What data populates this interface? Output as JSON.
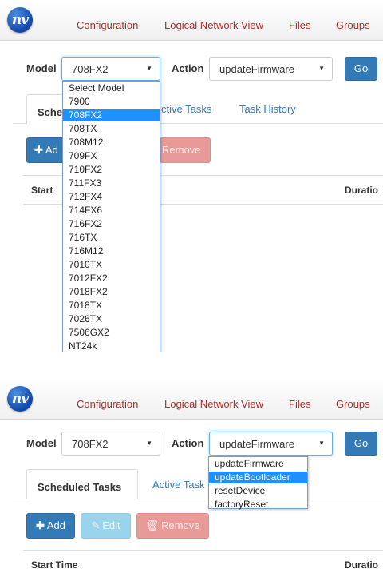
{
  "logo_text": "nv",
  "nav": {
    "items": [
      "Configuration",
      "Logical Network View",
      "Files",
      "Groups"
    ]
  },
  "panel1": {
    "model_label": "Model",
    "model_value": "708FX2",
    "action_label": "Action",
    "action_value": "updateFirmware",
    "go_label": "Go",
    "tab_scheduled_partial": "Sche",
    "tab_active_partial": "ctive Tasks",
    "tab_history": "Task History",
    "add_partial": "Ad",
    "remove_label": "Remove",
    "col_start_partial": "Start",
    "col_duration_partial": "Duratio",
    "model_options": [
      "Select Model",
      "7900",
      "708FX2",
      "708TX",
      "708M12",
      "709FX",
      "710FX2",
      "711FX3",
      "712FX4",
      "714FX6",
      "716FX2",
      "716TX",
      "716M12",
      "7010TX",
      "7012FX2",
      "7018FX2",
      "7018TX",
      "7026TX",
      "7506GX2",
      "NT24k"
    ],
    "model_selected_index": 2
  },
  "panel2": {
    "model_label": "Model",
    "model_value": "708FX2",
    "action_label": "Action",
    "action_value": "updateFirmware",
    "go_label": "Go",
    "tab_scheduled": "Scheduled Tasks",
    "tab_active_partial": "Active Task",
    "add_label": "Add",
    "edit_label": "Edit",
    "remove_label": "Remove",
    "col_start": "Start Time",
    "col_duration_partial": "Duratio",
    "action_options": [
      "updateFirmware",
      "updateBootloader",
      "resetDevice",
      "factoryReset"
    ],
    "action_selected_index": 1
  },
  "colors": {
    "nav_link": "#b22a2a",
    "primary": "#337ab7",
    "tab_link": "#337ab7",
    "dropdown_highlight": "#1e90ff",
    "danger_disabled": "#e79a98",
    "info_disabled": "#9ad3ec"
  },
  "icons": [
    "plus-icon",
    "edit-icon",
    "trash-icon",
    "caret-down-icon"
  ]
}
